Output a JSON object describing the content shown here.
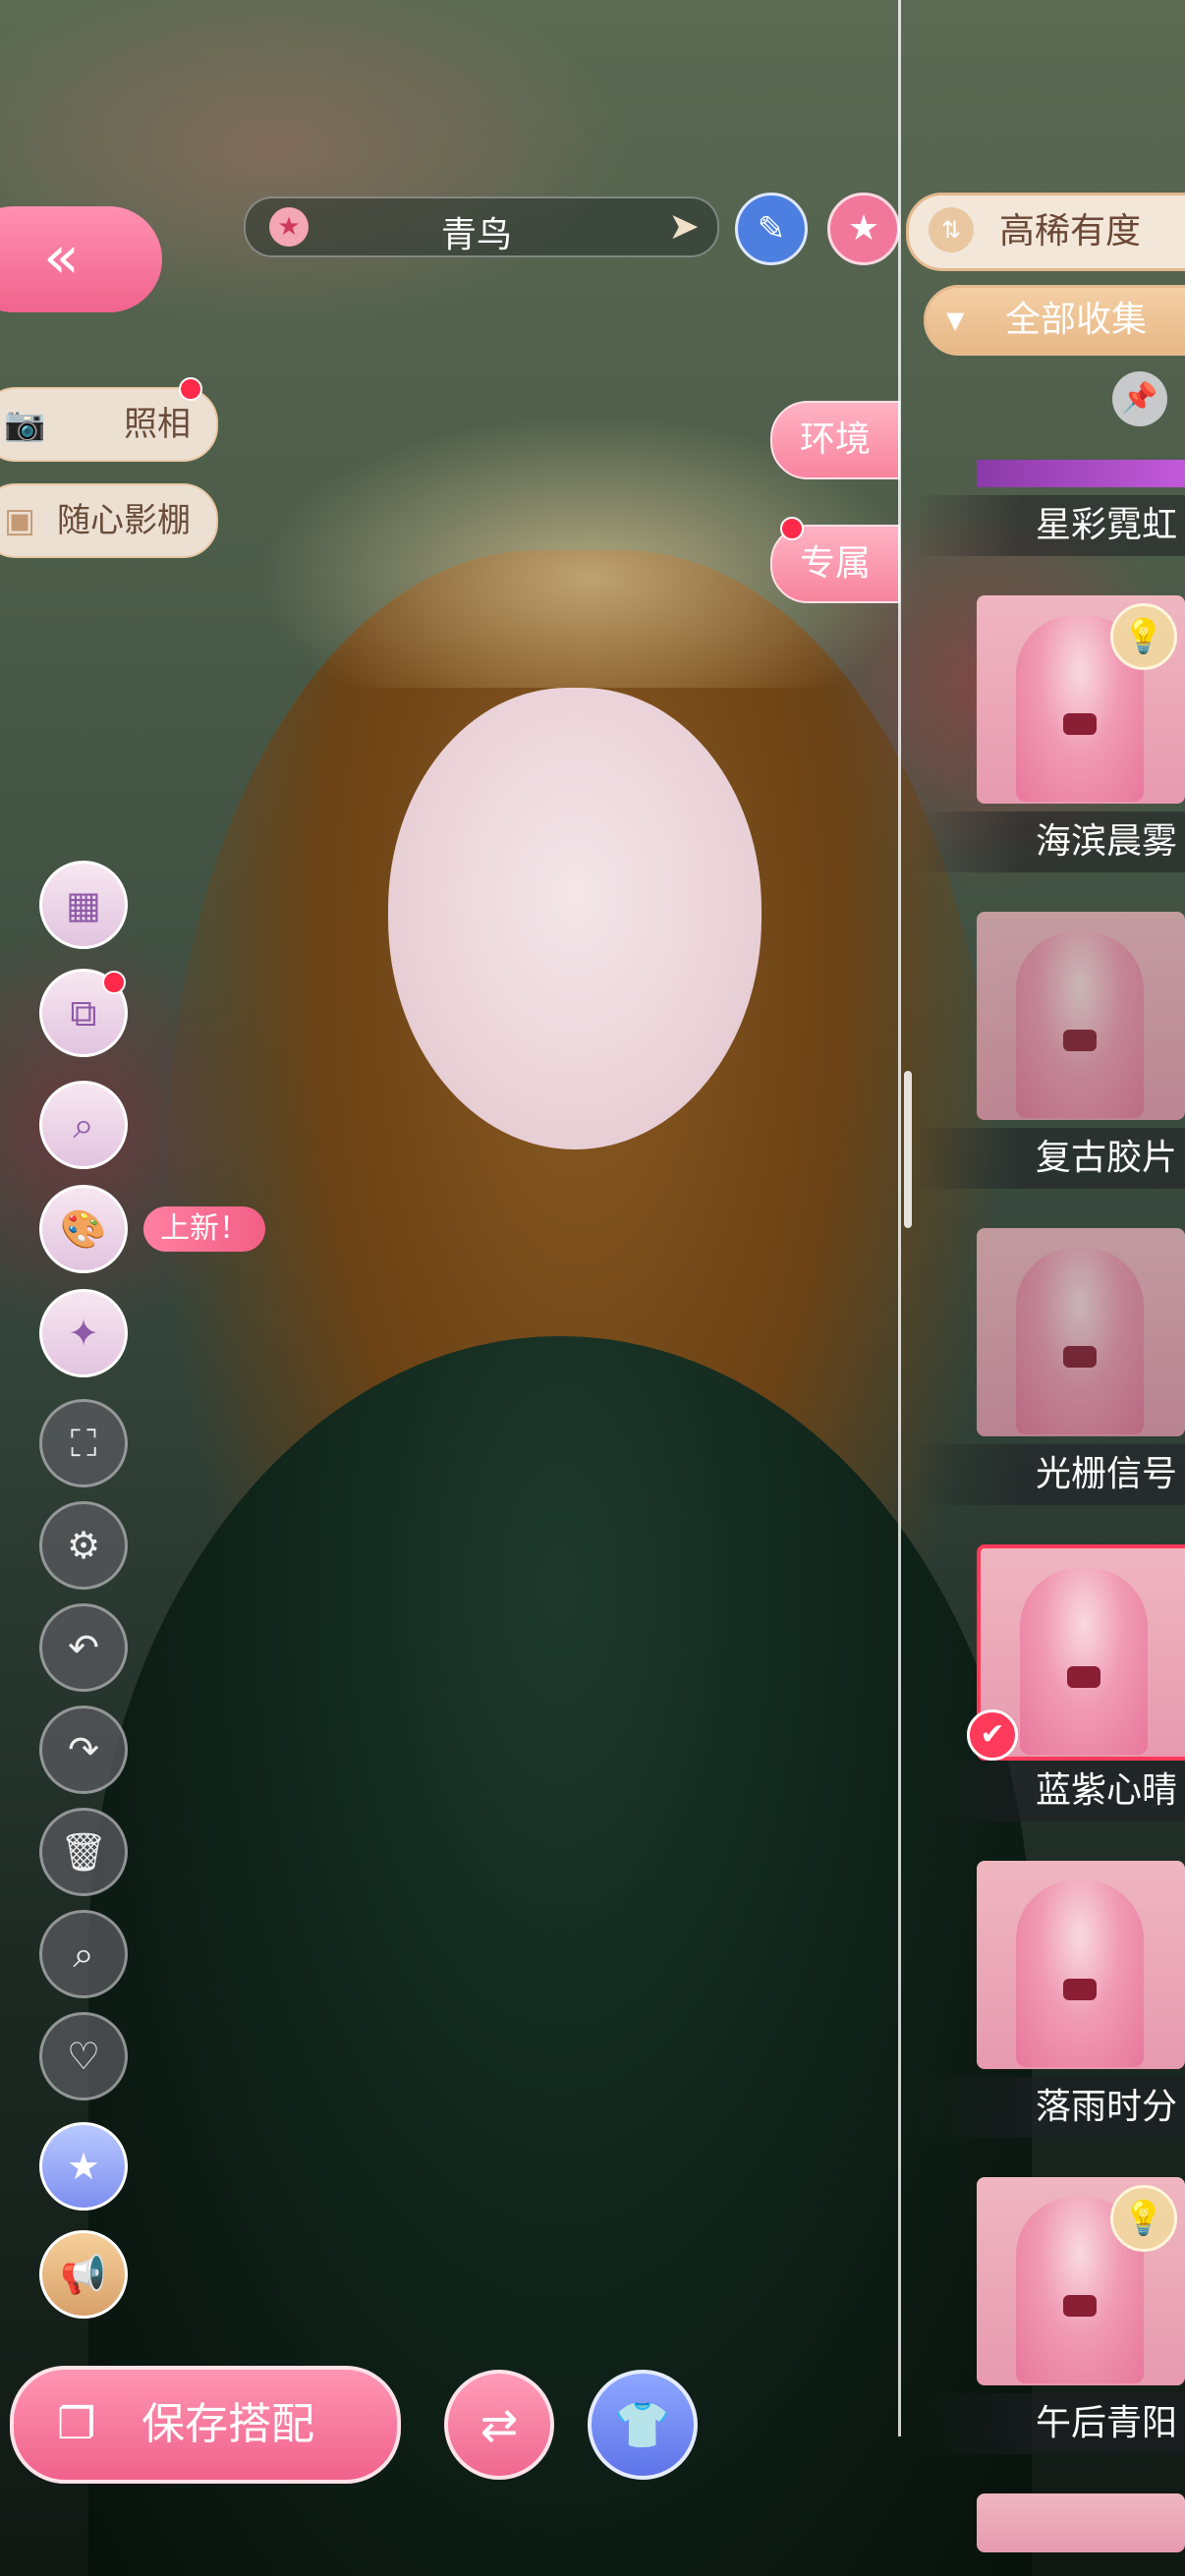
{
  "character": {
    "name": "青鸟"
  },
  "left_panel": {
    "back_icon": "double-chevron-left-icon",
    "photo_label": "照相",
    "studio_label": "随心影棚"
  },
  "side_tabs": {
    "environment": "环境",
    "exclusive": "专属"
  },
  "right_panel": {
    "sort_label": "高稀有度",
    "filter_label": "全部收集",
    "items": [
      {
        "label": "星彩霓虹"
      },
      {
        "label": "海滨晨雾"
      },
      {
        "label": "复古胶片"
      },
      {
        "label": "光栅信号"
      },
      {
        "label": "蓝紫心晴"
      },
      {
        "label": "落雨时分"
      },
      {
        "label": "午后青阳"
      }
    ]
  },
  "toolbar": {
    "new_tag": "上新！"
  },
  "bottom": {
    "save_label": "保存搭配"
  },
  "colors": {
    "accent_pink": "#f0648e",
    "accent_blue": "#5e74e8",
    "selected_border": "#ff3a5a"
  }
}
